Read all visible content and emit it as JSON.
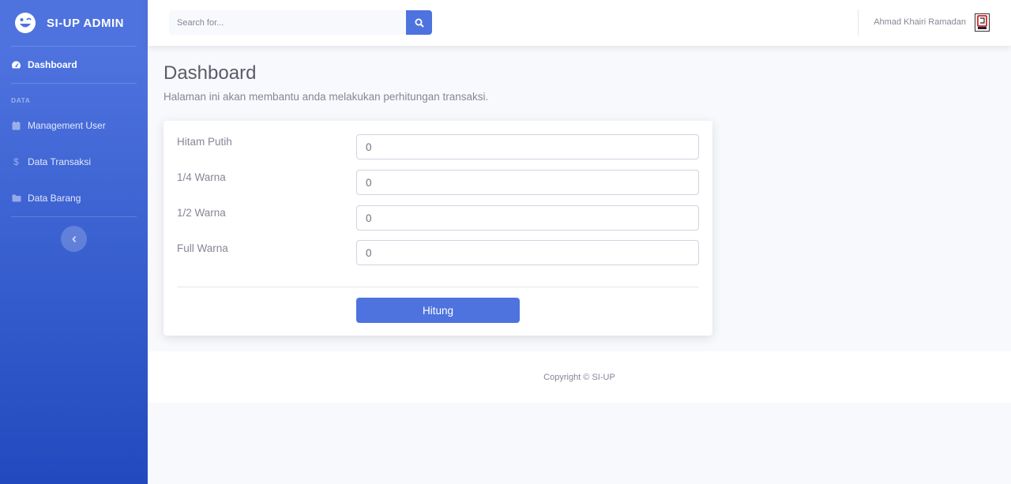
{
  "brand": {
    "name": "SI-UP ADMIN"
  },
  "sidebar": {
    "items": [
      {
        "label": "Dashboard",
        "icon": "tachometer-icon"
      },
      {
        "label": "Management User",
        "icon": "calendar-icon"
      },
      {
        "label": "Data Transaksi",
        "icon": "dollar-icon"
      },
      {
        "label": "Data Barang",
        "icon": "folder-icon"
      }
    ],
    "heading": "DATA"
  },
  "topbar": {
    "search_placeholder": "Search for...",
    "user_name": "Ahmad Khairi Ramadan"
  },
  "main": {
    "title": "Dashboard",
    "description": "Halaman ini akan membantu anda melakukan perhitungan transaksi.",
    "form": {
      "fields": [
        {
          "label": "Hitam Putih",
          "value": "0"
        },
        {
          "label": "1/4 Warna",
          "value": "0"
        },
        {
          "label": "1/2 Warna",
          "value": "0"
        },
        {
          "label": "Full Warna",
          "value": "0"
        }
      ],
      "submit_label": "Hitung"
    }
  },
  "footer": {
    "copyright": "Copyright © SI-UP"
  },
  "colors": {
    "primary": "#4e73df",
    "sidebar_end": "#224abe",
    "text_muted": "#858796"
  }
}
